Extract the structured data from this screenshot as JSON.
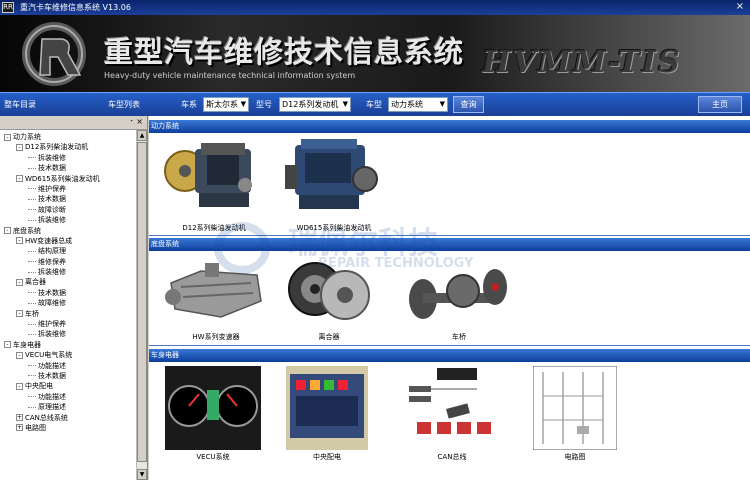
{
  "window": {
    "title": "重汽卡车维修信息系统  V13.06",
    "close": "×",
    "app_icon": "RR"
  },
  "banner": {
    "title": "重型汽车维修技术信息系统",
    "subtitle": "Heavy-duty vehicle maintenance technical information system",
    "brand": "HVMM-TIS"
  },
  "toolbar": {
    "directory_label": "整车目录",
    "vehicle_list_label": "车型列表",
    "series_label": "车系",
    "series_value": "斯太尔系",
    "model_label": "型号",
    "model_value": "D12系列发动机",
    "type_label": "车型",
    "type_value": "动力系统",
    "query_button": "查询",
    "home_button": "主页"
  },
  "left_panel": {
    "pin": "ᐩ",
    "close": "×",
    "tree": [
      {
        "level": 0,
        "expander": "-",
        "label": "动力系统"
      },
      {
        "level": 1,
        "expander": "-",
        "label": "D12系列柴油发动机"
      },
      {
        "level": 2,
        "expander": "",
        "label": "拆装维修"
      },
      {
        "level": 2,
        "expander": "",
        "label": "技术数据"
      },
      {
        "level": 1,
        "expander": "-",
        "label": "WD615系列柴油发动机"
      },
      {
        "level": 2,
        "expander": "",
        "label": "维护保养"
      },
      {
        "level": 2,
        "expander": "",
        "label": "技术数据"
      },
      {
        "level": 2,
        "expander": "",
        "label": "故障诊断"
      },
      {
        "level": 2,
        "expander": "",
        "label": "拆装维修"
      },
      {
        "level": 0,
        "expander": "-",
        "label": "底盘系统"
      },
      {
        "level": 1,
        "expander": "-",
        "label": "HW变速器总成"
      },
      {
        "level": 2,
        "expander": "",
        "label": "结构原理"
      },
      {
        "level": 2,
        "expander": "",
        "label": "维修保养"
      },
      {
        "level": 2,
        "expander": "",
        "label": "拆装维修"
      },
      {
        "level": 1,
        "expander": "-",
        "label": "离合器"
      },
      {
        "level": 2,
        "expander": "",
        "label": "技术数据"
      },
      {
        "level": 2,
        "expander": "",
        "label": "故障维修"
      },
      {
        "level": 1,
        "expander": "-",
        "label": "车桥"
      },
      {
        "level": 2,
        "expander": "",
        "label": "维护保养"
      },
      {
        "level": 2,
        "expander": "",
        "label": "拆装维修"
      },
      {
        "level": 0,
        "expander": "-",
        "label": "车身电器"
      },
      {
        "level": 1,
        "expander": "-",
        "label": "VECU电气系统"
      },
      {
        "level": 2,
        "expander": "",
        "label": "功能描述"
      },
      {
        "level": 2,
        "expander": "",
        "label": "技术数据"
      },
      {
        "level": 1,
        "expander": "-",
        "label": "中央配电"
      },
      {
        "level": 2,
        "expander": "",
        "label": "功能描述"
      },
      {
        "level": 2,
        "expander": "",
        "label": "原理描述"
      },
      {
        "level": 1,
        "expander": "+",
        "label": "CAN总线系统"
      },
      {
        "level": 1,
        "expander": "+",
        "label": "电路图"
      }
    ]
  },
  "sections": [
    {
      "title": "动力系统",
      "items": [
        {
          "caption": "D12系列柴油发动机",
          "icon": "engine-icon"
        },
        {
          "caption": "WD615系列柴油发动机",
          "icon": "engine-icon"
        }
      ]
    },
    {
      "title": "底盘系统",
      "items": [
        {
          "caption": "HW系列变速器",
          "icon": "gearbox-icon"
        },
        {
          "caption": "离合器",
          "icon": "clutch-icon"
        },
        {
          "caption": "车桥",
          "icon": "axle-icon"
        }
      ]
    },
    {
      "title": "车身电器",
      "items": [
        {
          "caption": "VECU系统",
          "icon": "dashboard-icon"
        },
        {
          "caption": "中央配电",
          "icon": "fusebox-icon"
        },
        {
          "caption": "CAN总线",
          "icon": "canbus-diagram-icon"
        },
        {
          "caption": "电路图",
          "icon": "circuit-diagram-icon"
        }
      ]
    }
  ],
  "watermark": {
    "cn": "瑞佩尔科技",
    "en": "REPAIR TECHNOLOGY"
  },
  "colors": {
    "toolbar": "#1f4fb0",
    "section_bar": "#0d3e9c",
    "window_title": "#0a246a"
  }
}
